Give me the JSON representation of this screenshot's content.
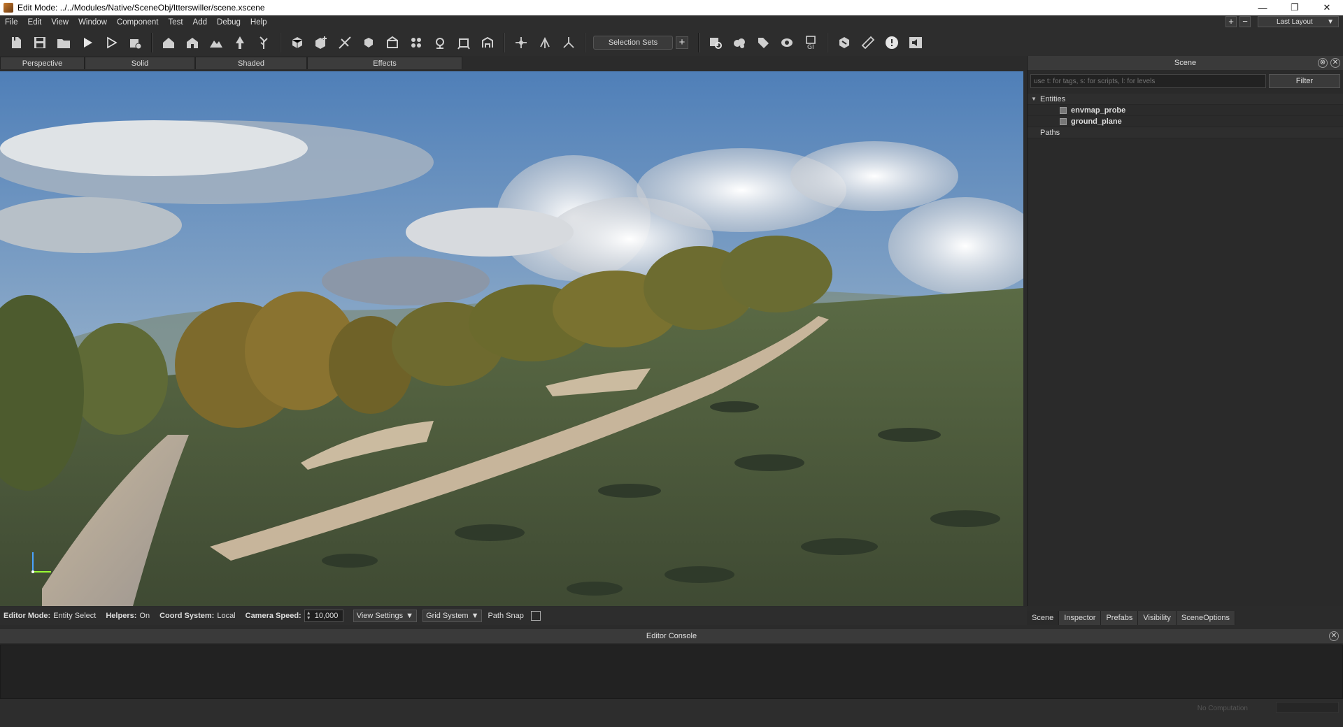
{
  "window": {
    "title": "Edit Mode: ../../Modules/Native/SceneObj/Itterswiller/scene.xscene",
    "buttons": [
      "minimize-icon",
      "restore-icon",
      "close-icon"
    ]
  },
  "menu": {
    "items": [
      "File",
      "Edit",
      "View",
      "Window",
      "Component",
      "Test",
      "Add",
      "Debug",
      "Help"
    ],
    "layout_label": "Last Layout",
    "plus": "+",
    "minus": "−"
  },
  "toolbar": {
    "selection_sets_label": "Selection Sets",
    "add_label": "+"
  },
  "view_tabs": [
    "Perspective",
    "Solid",
    "Shaded",
    "Effects"
  ],
  "status_bar": {
    "editor_mode_label": "Editor Mode:",
    "editor_mode_value": "Entity Select",
    "helpers_label": "Helpers:",
    "helpers_value": "On",
    "coord_label": "Coord System:",
    "coord_value": "Local",
    "camera_speed_label": "Camera Speed:",
    "camera_speed_value": "10,000",
    "view_settings": "View Settings",
    "grid_system": "Grid System",
    "path_snap": "Path Snap"
  },
  "scene_panel": {
    "title": "Scene",
    "search_placeholder": "use t: for tags, s: for scripts, l: for levels",
    "filter_label": "Filter",
    "tree": {
      "entities_label": "Entities",
      "children": [
        "envmap_probe",
        "ground_plane"
      ],
      "paths_label": "Paths"
    }
  },
  "panel_tabs": [
    "Scene",
    "Inspector",
    "Prefabs",
    "Visibility",
    "SceneOptions"
  ],
  "console": {
    "title": "Editor Console",
    "status": "No Computation"
  },
  "colors": {
    "chrome": "#2d2d2d",
    "panel": "#2a2a2a",
    "header": "#3a3a3a",
    "sky": "#6a8fb5"
  }
}
